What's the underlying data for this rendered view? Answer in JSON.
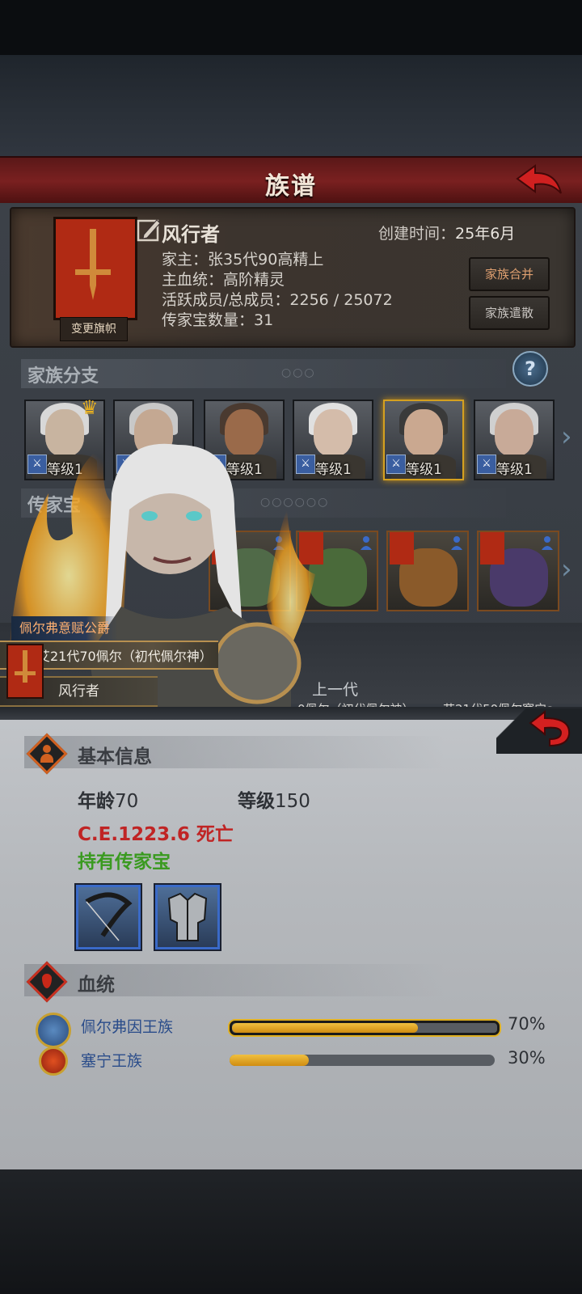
{
  "header": {
    "title": "族谱"
  },
  "family": {
    "name": "风行者",
    "created_label": "创建时间：",
    "created_value": "25年6月",
    "leader": "家主：张35代90高精上",
    "main_bloodline": "主血统：高阶精灵",
    "members": "活跃成员/总成员：2256 / 25072",
    "heirloom_count": "传家宝数量：31",
    "change_flag_label": "变更旗帜",
    "merge_label": "家族合并",
    "dissolve_label": "家族遣散"
  },
  "branches": {
    "title": "家族分支",
    "dots": "○○○",
    "portraits": [
      {
        "level": "等级1",
        "skin": "#c8b4a0",
        "hair": "#d8d8d8",
        "crown": true,
        "selected": false
      },
      {
        "level": "等级1",
        "skin": "#c4a892",
        "hair": "#c8c8c8",
        "crown": false,
        "selected": false
      },
      {
        "level": "等级1",
        "skin": "#9a6a4a",
        "hair": "#4a3a30",
        "crown": false,
        "selected": false
      },
      {
        "level": "等级1",
        "skin": "#d4bcaa",
        "hair": "#e0e0e0",
        "crown": false,
        "selected": false
      },
      {
        "level": "等级1",
        "skin": "#caa890",
        "hair": "#3a3a3a",
        "crown": false,
        "selected": true
      },
      {
        "level": "等级1",
        "skin": "#c8aa98",
        "hair": "#d0d0d0",
        "crown": false,
        "selected": false
      }
    ]
  },
  "heirlooms": {
    "title": "传家宝",
    "dots": "○○○○○○",
    "items": [
      {
        "art": "#7a8a70"
      },
      {
        "art": "#506a48"
      },
      {
        "art": "#4a6a3a"
      },
      {
        "art": "#8a5a2a"
      },
      {
        "art": "#4a3a6a"
      }
    ]
  },
  "lineage": {
    "prev_label": "上一代",
    "prev1": "0佩尔（初代佩尔神）",
    "prev2": "艾21代50佩尔塞宁s"
  },
  "character": {
    "title": "佩尔弗意赋公爵",
    "name": "艾21代70佩尔（初代佩尔神）",
    "family": "风行者"
  },
  "basic_info": {
    "title": "基本信息",
    "age_label": "年龄",
    "age": "70",
    "level_label": "等级",
    "level": "150",
    "death": "C.E.1223.6 死亡",
    "heirloom_status": "持有传家宝",
    "items": [
      "bow-icon",
      "armor-icon"
    ]
  },
  "bloodline": {
    "title": "血统",
    "entries": [
      {
        "name": "佩尔弗因王族",
        "percent": "70%",
        "value": 0.7
      },
      {
        "name": "塞宁王族",
        "percent": "30%",
        "value": 0.3
      }
    ]
  },
  "colors": {
    "accent": "#d4a020",
    "death": "#c02424",
    "heirloom": "#3a9a20",
    "banner": "#b02a14"
  }
}
